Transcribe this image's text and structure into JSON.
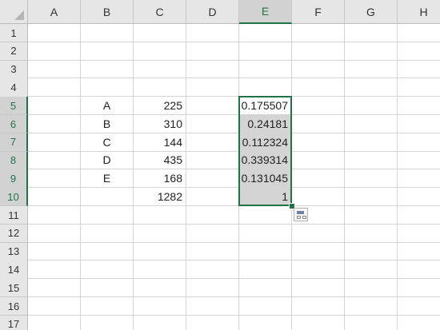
{
  "columns": [
    "A",
    "B",
    "C",
    "D",
    "E",
    "F",
    "G",
    "H"
  ],
  "selected_column": "E",
  "rows": [
    "1",
    "2",
    "3",
    "4",
    "5",
    "6",
    "7",
    "8",
    "9",
    "10",
    "11",
    "12",
    "13",
    "14",
    "15",
    "16",
    "17"
  ],
  "selected_rows": [
    "5",
    "6",
    "7",
    "8",
    "9",
    "10"
  ],
  "cells": [
    {
      "ref": "B5",
      "value": "A",
      "align": "center"
    },
    {
      "ref": "C5",
      "value": "225",
      "align": "right"
    },
    {
      "ref": "E5",
      "value": "0.175507",
      "align": "right",
      "shaded": false
    },
    {
      "ref": "B6",
      "value": "B",
      "align": "center"
    },
    {
      "ref": "C6",
      "value": "310",
      "align": "right"
    },
    {
      "ref": "E6",
      "value": "0.24181",
      "align": "right",
      "shaded": true
    },
    {
      "ref": "B7",
      "value": "C",
      "align": "center"
    },
    {
      "ref": "C7",
      "value": "144",
      "align": "right"
    },
    {
      "ref": "E7",
      "value": "0.112324",
      "align": "right",
      "shaded": true
    },
    {
      "ref": "B8",
      "value": "D",
      "align": "center"
    },
    {
      "ref": "C8",
      "value": "435",
      "align": "right"
    },
    {
      "ref": "E8",
      "value": "0.339314",
      "align": "right",
      "shaded": true
    },
    {
      "ref": "B9",
      "value": "E",
      "align": "center"
    },
    {
      "ref": "C9",
      "value": "168",
      "align": "right"
    },
    {
      "ref": "E9",
      "value": "0.131045",
      "align": "right",
      "shaded": true
    },
    {
      "ref": "C10",
      "value": "1282",
      "align": "right"
    },
    {
      "ref": "E10",
      "value": "1",
      "align": "right",
      "shaded": true
    }
  ],
  "selection": {
    "range": "E5:E10"
  },
  "quick_analysis": {
    "icon": "quick-analysis-icon"
  },
  "colors": {
    "accent": "#217346",
    "header_bg": "#e6e6e6",
    "selection_fill": "#d4d4d4",
    "gridline": "#d4d4d4"
  }
}
